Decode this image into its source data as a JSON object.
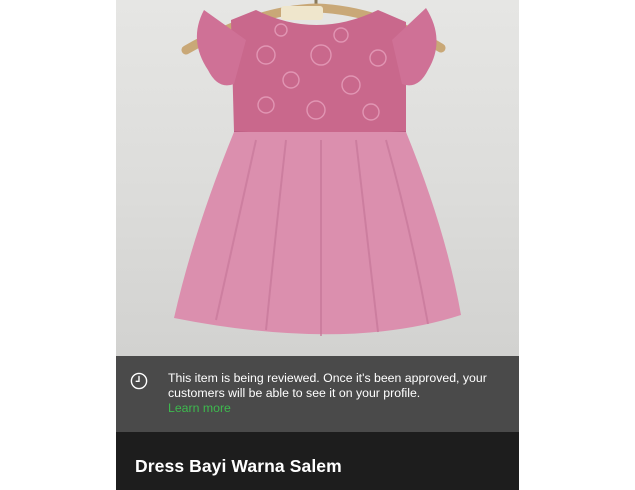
{
  "product": {
    "title": "Dress Bayi Warna Salem",
    "image_icon": "pink-lace-dress-photo"
  },
  "review_banner": {
    "message": "This item is being reviewed. Once it's been approved, your customers will be able to see it on your profile.",
    "learn_more": "Learn more",
    "icon": "clock-icon"
  },
  "colors": {
    "banner_bg": "#4a4a4a",
    "title_bar_bg": "#1d1d1d",
    "link": "#3dba4e",
    "dress": "#d98aa8"
  }
}
